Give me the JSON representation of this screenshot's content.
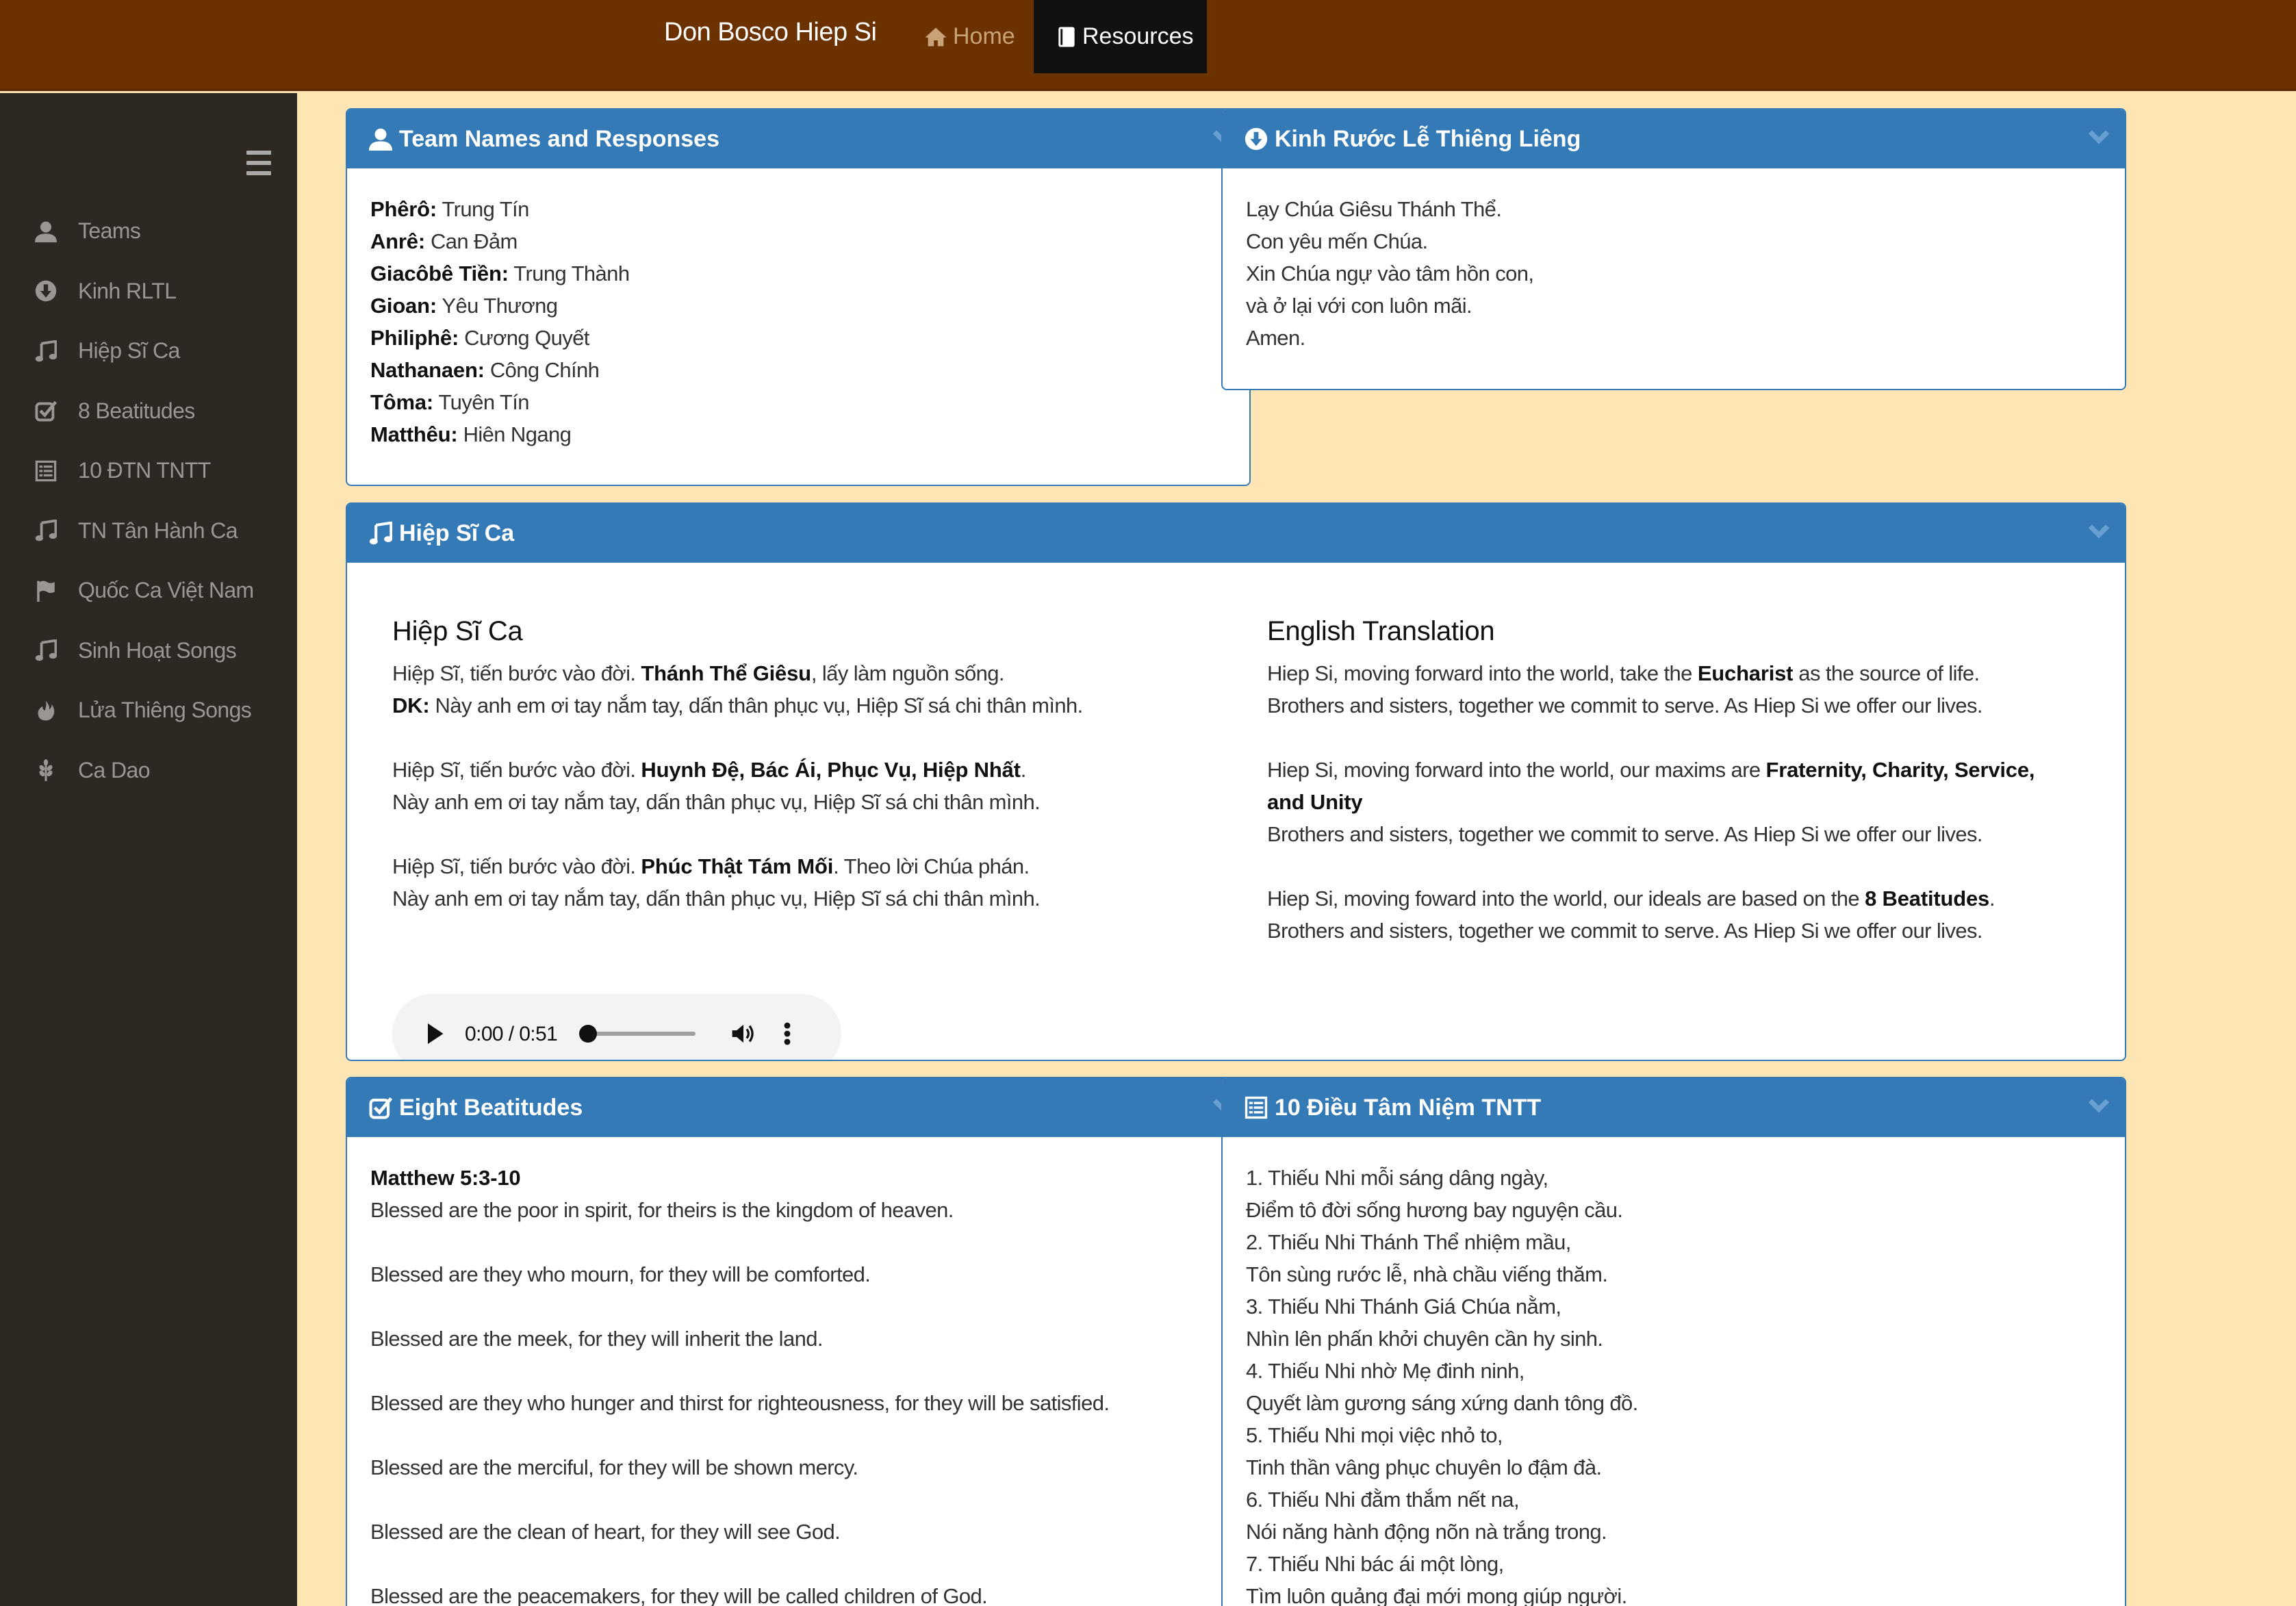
{
  "nav": {
    "brand": "Don Bosco Hiep Si",
    "home_label": "Home",
    "resources_label": "Resources"
  },
  "sidebar": {
    "items": [
      {
        "label": "Teams",
        "icon": "user-icon"
      },
      {
        "label": "Kinh RLTL",
        "icon": "download-circle-icon"
      },
      {
        "label": "Hiệp Sĩ Ca",
        "icon": "music-icon"
      },
      {
        "label": "8 Beatitudes",
        "icon": "check-square-icon"
      },
      {
        "label": "10 ĐTN TNTT",
        "icon": "list-alt-icon"
      },
      {
        "label": "TN Tân Hành Ca",
        "icon": "music-icon"
      },
      {
        "label": "Quốc Ca Việt Nam",
        "icon": "flag-icon"
      },
      {
        "label": "Sinh Hoạt Songs",
        "icon": "music-icon"
      },
      {
        "label": "Lửa Thiêng Songs",
        "icon": "fire-icon"
      },
      {
        "label": "Ca Dao",
        "icon": "grain-icon"
      }
    ]
  },
  "teams_panel": {
    "title": "Team Names and Responses",
    "rows": [
      {
        "name": "Phêrô:",
        "resp": "Trung Tín"
      },
      {
        "name": "Anrê:",
        "resp": "Can Đảm"
      },
      {
        "name": "Giacôbê Tiền:",
        "resp": "Trung Thành"
      },
      {
        "name": "Gioan:",
        "resp": "Yêu Thương"
      },
      {
        "name": "Philiphê:",
        "resp": "Cương Quyết"
      },
      {
        "name": "Nathanaen:",
        "resp": "Công Chính"
      },
      {
        "name": "Tôma:",
        "resp": "Tuyên Tín"
      },
      {
        "name": "Matthêu:",
        "resp": "Hiên Ngang"
      }
    ]
  },
  "kinh_panel": {
    "title": "Kinh Rước Lễ Thiêng Liêng",
    "lines": [
      "Lạy Chúa Giêsu Thánh Thể.",
      "Con yêu mến Chúa.",
      "Xin Chúa ngự vào tâm hồn con,",
      "và ở lại với con luôn mãi.",
      "Amen."
    ]
  },
  "hiepsica_panel": {
    "title": "Hiệp Sĩ Ca",
    "vn_heading": "Hiệp Sĩ Ca",
    "vn": {
      "v1a": "Hiệp Sĩ, tiến bước vào đời. ",
      "v1b": "Thánh Thể Giêsu",
      "v1c": ", lấy làm nguồn sống.",
      "dk": "DK:",
      "dk_text": " Này anh em ơi tay nắm tay, dấn thân phục vụ, Hiệp Sĩ sá chi thân mình.",
      "v2a": "Hiệp Sĩ, tiến bước vào đời. ",
      "v2b": "Huynh Đệ, Bác Ái, Phục Vụ, Hiệp Nhất",
      "v2c": ".",
      "refrain": "Này anh em ơi tay nắm tay, dấn thân phục vụ, Hiệp Sĩ sá chi thân mình.",
      "v3a": "Hiệp Sĩ, tiến bước vào đời. ",
      "v3b": "Phúc Thật Tám Mối",
      "v3c": ". Theo lời Chúa phán."
    },
    "en_heading": "English Translation",
    "en": {
      "v1a": "Hiep Si, moving forward into the world, take the ",
      "v1b": "Eucharist",
      "v1c": " as the source of life.",
      "refrain": "Brothers and sisters, together we commit to serve. As Hiep Si we offer our lives.",
      "v2a": "Hiep Si, moving forward into the world, our maxims are ",
      "v2b": "Fraternity, Charity, Service,",
      "v2c": "and Unity",
      "v3a": "Hiep Si, moving foward into the world, our ideals are based on the ",
      "v3b": "8 Beatitudes",
      "v3c": "."
    },
    "audio": {
      "time": "0:00 / 0:51",
      "progress": 0
    }
  },
  "beatitudes_panel": {
    "title": "Eight Beatitudes",
    "ref": "Matthew 5:3-10",
    "lines": [
      "Blessed are the poor in spirit, for theirs is the kingdom of heaven.",
      "Blessed are they who mourn, for they will be comforted.",
      "Blessed are the meek, for they will inherit the land.",
      "Blessed are they who hunger and thirst for righteousness, for they will be satisfied.",
      "Blessed are the merciful, for they will be shown mercy.",
      "Blessed are the clean of heart, for they will see God.",
      "Blessed are the peacemakers, for they will be called children of God."
    ]
  },
  "tnt_panel": {
    "title": "10 Điều Tâm Niệm TNTT",
    "lines": [
      "1. Thiếu Nhi mỗi sáng dâng ngày,",
      "Điểm tô đời sống hương bay nguyện cầu.",
      "2. Thiếu Nhi Thánh Thể nhiệm mầu,",
      "Tôn sùng rước lễ, nhà chầu viếng thăm.",
      "3. Thiếu Nhi Thánh Giá Chúa nằm,",
      "Nhìn lên phấn khởi chuyên cần hy sinh.",
      "4. Thiếu Nhi nhờ Mẹ đinh ninh,",
      "Quyết làm gương sáng xứng danh tông đồ.",
      "5. Thiếu Nhi mọi việc nhỏ to,",
      "Tinh thần vâng phục chuyên lo đậm đà.",
      "6. Thiếu Nhi đằm thắm nết na,",
      "Nói năng hành động nõn nà trắng trong.",
      "7. Thiếu Nhi bác ái một lòng,",
      "Tìm luôn quảng đại mới mong giúp người."
    ]
  }
}
